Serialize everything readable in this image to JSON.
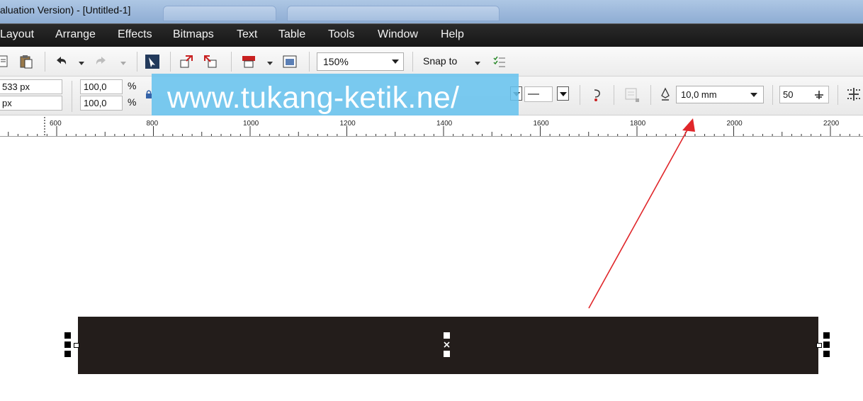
{
  "window": {
    "title": "aluation Version) - [Untitled-1]"
  },
  "menu": {
    "items": [
      "Layout",
      "Arrange",
      "Effects",
      "Bitmaps",
      "Text",
      "Table",
      "Tools",
      "Window",
      "Help"
    ]
  },
  "toolbar": {
    "zoom_value": "150%",
    "snap_label": "Snap to"
  },
  "property_bar": {
    "width_value": "533 px",
    "height_value": "px",
    "scale_x": "100,0",
    "scale_y": "100,0",
    "percent_symbol": "%",
    "line_dash_symbol": "—",
    "outline_width": "10,0 mm",
    "steps_value": "50"
  },
  "watermark": {
    "text": "www.tukang-ketik.ne/"
  },
  "ruler": {
    "labels": [
      "600",
      "800",
      "1000",
      "1200",
      "1400",
      "1600",
      "1800",
      "2000",
      "2200"
    ]
  },
  "colors": {
    "menubar": "#1c1c1c",
    "rectangle_fill": "#231d1b",
    "annotation_arrow": "#e0262a",
    "watermark": "#68c3ee"
  },
  "icons": [
    "copy-icon",
    "paste-icon",
    "undo-icon",
    "redo-icon",
    "pick-icon",
    "import-icon",
    "export-icon",
    "publish-icon",
    "app-launcher-icon",
    "snap-options-icon",
    "lock-ratio-icon",
    "outline-pen-icon",
    "fill-icon",
    "mirror-icon",
    "steps-icon"
  ]
}
